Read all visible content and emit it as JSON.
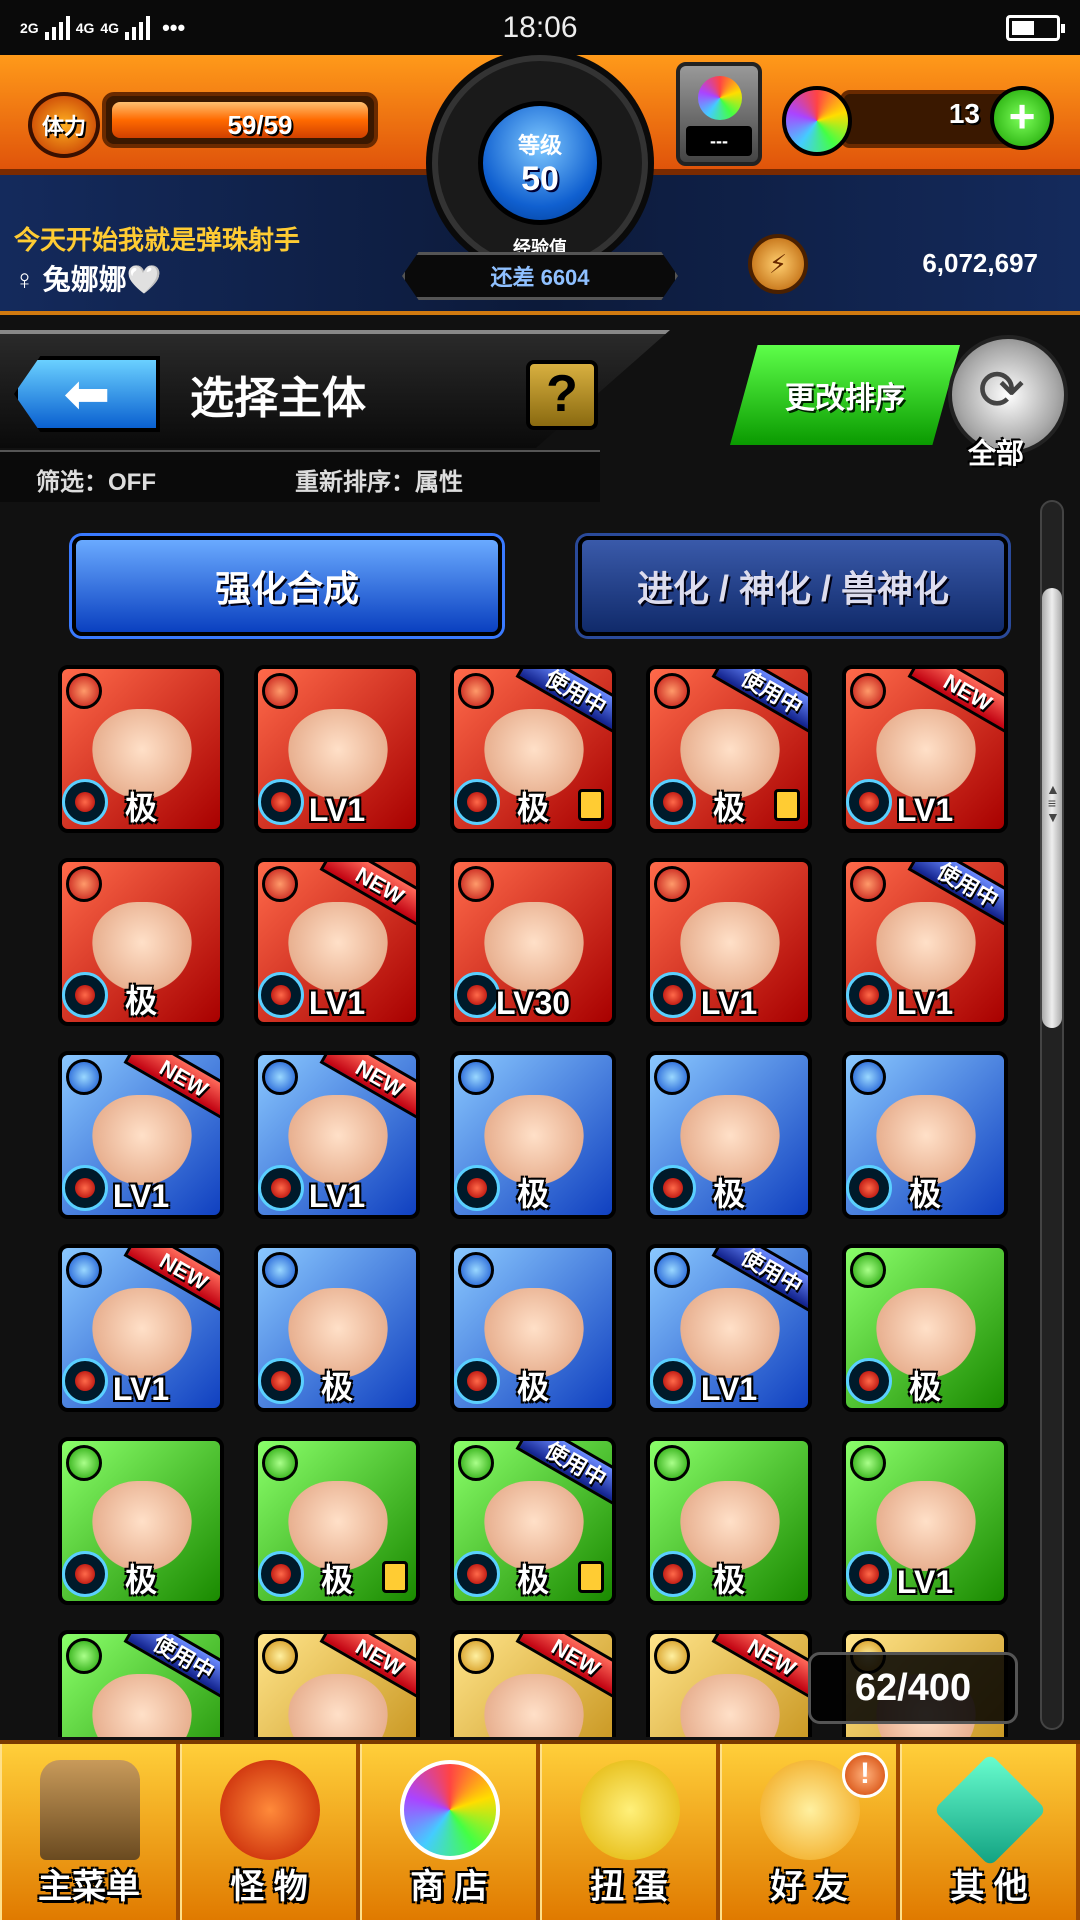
{
  "status_bar": {
    "signal1": "2G",
    "signal2": "4G",
    "signal2b": "4G",
    "dots": "•••",
    "time": "18:06"
  },
  "hud": {
    "stamina_label": "体力",
    "stamina_text": "59/59",
    "stamina_fraction": 1.0,
    "level_label": "等级",
    "level_value": "50",
    "exp_label": "经验值",
    "exp_remaining": "还差 6604",
    "gacha_display": "---",
    "orb_count": "13",
    "player_title": "今天开始我就是弹珠射手",
    "player_name": "♀ 兔娜娜🤍",
    "coins": "6,072,697"
  },
  "header": {
    "page_title": "选择主体",
    "help_label": "?",
    "back_icon": "back-arrow-icon",
    "filter_text": "筛选：OFF",
    "sort_text": "重新排序：属性",
    "sort_change_label": "更改排序",
    "all_label": "全部"
  },
  "modes": {
    "enhance_label": "强化合成",
    "evolve_label": "进化 / 神化 / 兽神化"
  },
  "monsters": [
    {
      "element": "fire",
      "bottom": "极",
      "badge": "",
      "locked": false
    },
    {
      "element": "fire",
      "bottom": "LV1",
      "badge": "",
      "locked": false
    },
    {
      "element": "fire",
      "bottom": "极",
      "badge": "使用中",
      "locked": true
    },
    {
      "element": "fire",
      "bottom": "极",
      "badge": "使用中",
      "locked": true
    },
    {
      "element": "fire",
      "bottom": "LV1",
      "badge": "NEW",
      "locked": false
    },
    {
      "element": "fire",
      "bottom": "极",
      "badge": "",
      "locked": false
    },
    {
      "element": "fire",
      "bottom": "LV1",
      "badge": "NEW",
      "locked": false
    },
    {
      "element": "fire",
      "bottom": "LV30",
      "badge": "",
      "locked": false
    },
    {
      "element": "fire",
      "bottom": "LV1",
      "badge": "",
      "locked": false
    },
    {
      "element": "fire",
      "bottom": "LV1",
      "badge": "使用中",
      "locked": false
    },
    {
      "element": "water",
      "bottom": "LV1",
      "badge": "NEW",
      "locked": false
    },
    {
      "element": "water",
      "bottom": "LV1",
      "badge": "NEW",
      "locked": false
    },
    {
      "element": "water",
      "bottom": "极",
      "badge": "",
      "locked": false
    },
    {
      "element": "water",
      "bottom": "极",
      "badge": "",
      "locked": false
    },
    {
      "element": "water",
      "bottom": "极",
      "badge": "",
      "locked": false
    },
    {
      "element": "water",
      "bottom": "LV1",
      "badge": "NEW",
      "locked": false
    },
    {
      "element": "water",
      "bottom": "极",
      "badge": "",
      "locked": false
    },
    {
      "element": "water",
      "bottom": "极",
      "badge": "",
      "locked": false
    },
    {
      "element": "water",
      "bottom": "LV1",
      "badge": "使用中",
      "locked": false
    },
    {
      "element": "wood",
      "bottom": "极",
      "badge": "",
      "locked": false
    },
    {
      "element": "wood",
      "bottom": "极",
      "badge": "",
      "locked": false
    },
    {
      "element": "wood",
      "bottom": "极",
      "badge": "",
      "locked": true
    },
    {
      "element": "wood",
      "bottom": "极",
      "badge": "使用中",
      "locked": true
    },
    {
      "element": "wood",
      "bottom": "极",
      "badge": "",
      "locked": false
    },
    {
      "element": "wood",
      "bottom": "LV1",
      "badge": "",
      "locked": false
    },
    {
      "element": "wood",
      "bottom": "",
      "badge": "使用中",
      "locked": false
    },
    {
      "element": "light",
      "bottom": "",
      "badge": "NEW",
      "locked": false
    },
    {
      "element": "light",
      "bottom": "",
      "badge": "NEW",
      "locked": false
    },
    {
      "element": "light",
      "bottom": "",
      "badge": "NEW",
      "locked": false
    },
    {
      "element": "light",
      "bottom": "",
      "badge": "",
      "locked": false
    }
  ],
  "box_count": "62/400",
  "nav": [
    {
      "label": "主菜单",
      "icon": "home-gate-icon"
    },
    {
      "label": "怪 物",
      "icon": "monster-icon"
    },
    {
      "label": "商 店",
      "icon": "orb-shop-icon"
    },
    {
      "label": "扭 蛋",
      "icon": "gacha-egg-icon"
    },
    {
      "label": "好 友",
      "icon": "friends-icon"
    },
    {
      "label": "其 他",
      "icon": "other-icon"
    }
  ],
  "notification_mark": "!"
}
